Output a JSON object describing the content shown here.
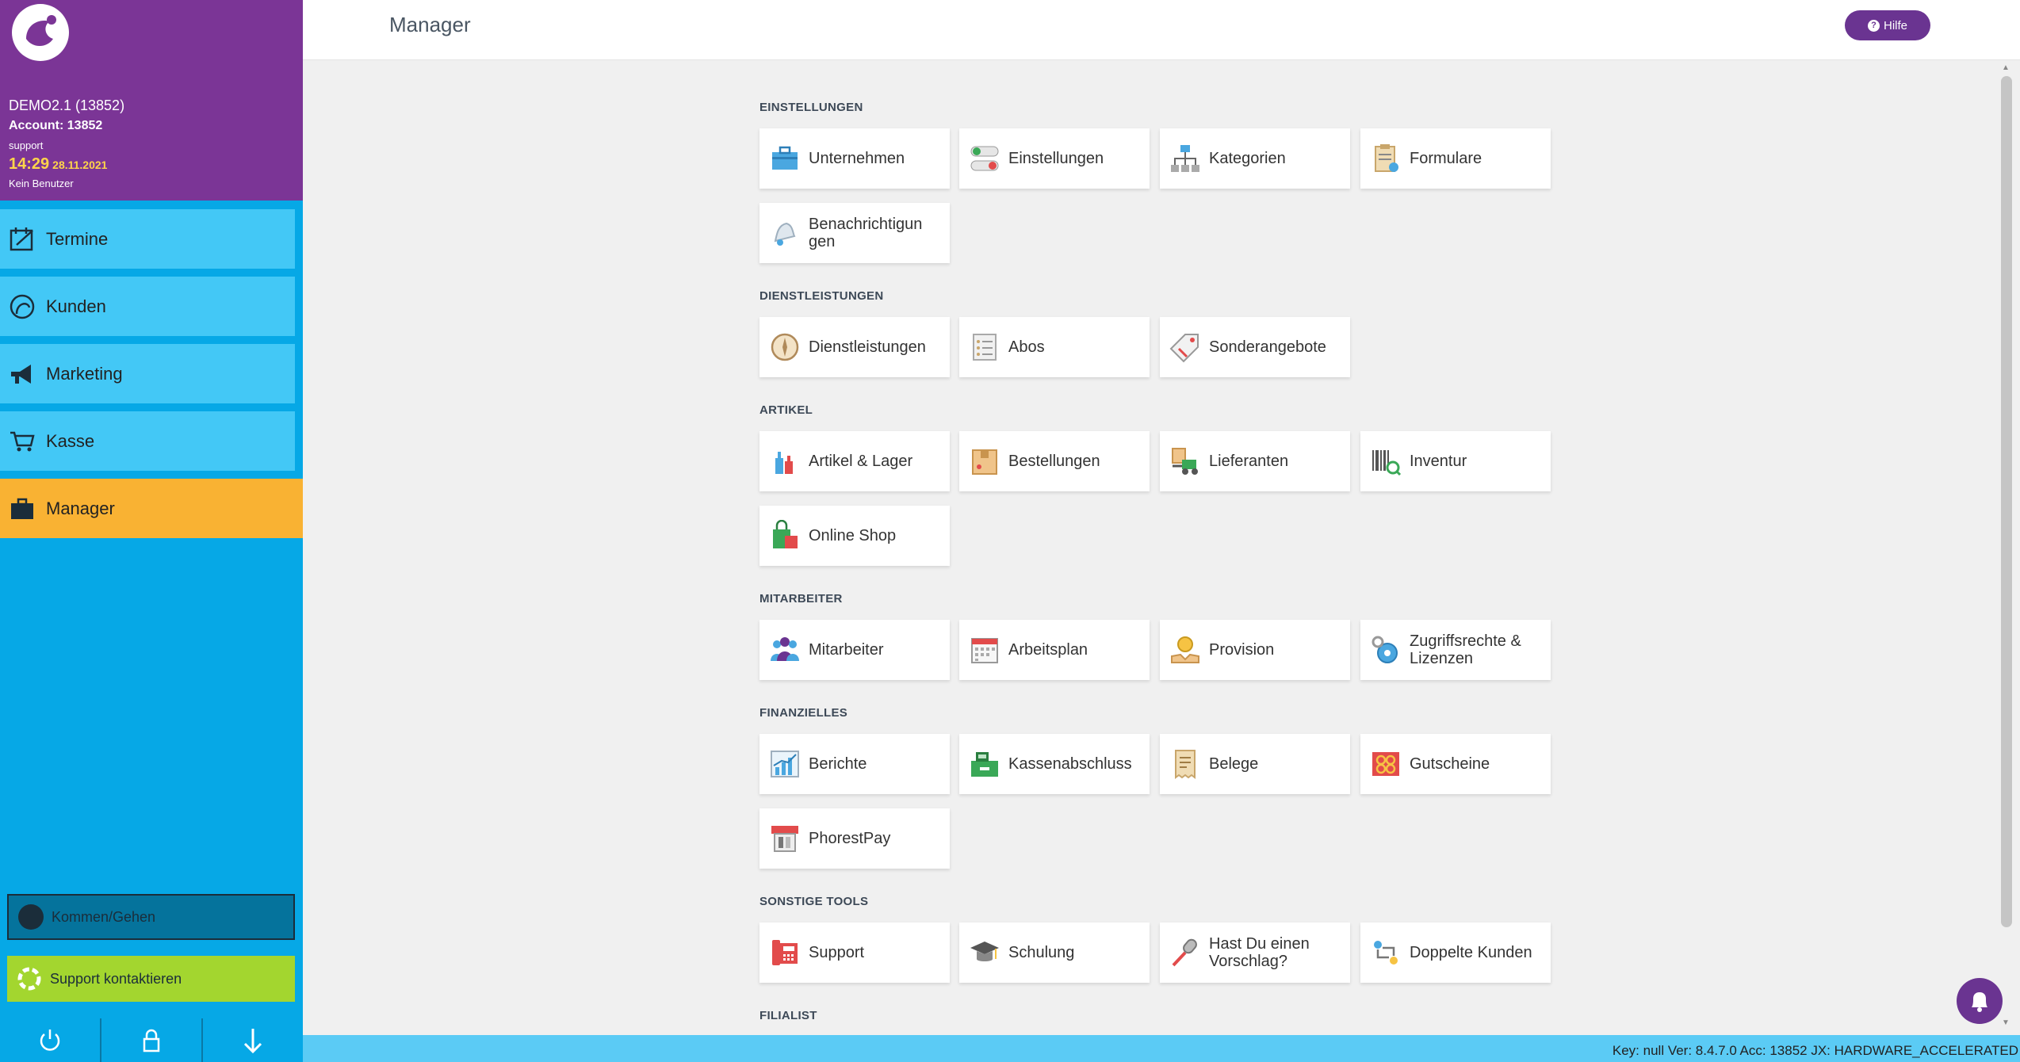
{
  "account": {
    "name": "DEMO2.1 (13852)",
    "number": "Account: 13852",
    "user": "support",
    "time": "14:29",
    "date": "28.11.2021",
    "no_user": "Kein Benutzer"
  },
  "nav": [
    {
      "label": "Termine",
      "icon": "calendar-icon"
    },
    {
      "label": "Kunden",
      "icon": "customer-icon"
    },
    {
      "label": "Marketing",
      "icon": "megaphone-icon"
    },
    {
      "label": "Kasse",
      "icon": "cart-icon"
    },
    {
      "label": "Manager",
      "icon": "briefcase-icon",
      "active": true
    }
  ],
  "sidebar_buttons": {
    "kommen": "Kommen/Gehen",
    "support": "Support kontaktieren"
  },
  "header": {
    "title": "Manager",
    "help": "Hilfe"
  },
  "sections": [
    {
      "title": "EINSTELLUNGEN",
      "tiles": [
        "Unternehmen",
        "Einstellungen",
        "Kategorien",
        "Formulare",
        "Benachrichtigungen"
      ]
    },
    {
      "title": "DIENSTLEISTUNGEN",
      "tiles": [
        "Dienstleistungen",
        "Abos",
        "Sonderangebote"
      ]
    },
    {
      "title": "ARTIKEL",
      "tiles": [
        "Artikel & Lager",
        "Bestellungen",
        "Lieferanten",
        "Inventur",
        "Online Shop"
      ]
    },
    {
      "title": "MITARBEITER",
      "tiles": [
        "Mitarbeiter",
        "Arbeitsplan",
        "Provision",
        "Zugriffsrechte & Lizenzen"
      ]
    },
    {
      "title": "FINANZIELLES",
      "tiles": [
        "Berichte",
        "Kassenabschluss",
        "Belege",
        "Gutscheine",
        "PhorestPay"
      ]
    },
    {
      "title": "SONSTIGE TOOLS",
      "tiles": [
        "Support",
        "Schulung",
        "Hast Du einen Vorschlag?",
        "Doppelte Kunden"
      ]
    },
    {
      "title": "FILIALIST",
      "tiles": []
    }
  ],
  "tile_labels_display": {
    "benachrichtigungen": "Benachrichtigun gen"
  },
  "status_bar": "Key: null Ver: 8.4.7.0 Acc: 13852  JX: HARDWARE_ACCELERATED",
  "colors": {
    "purple": "#7b3596",
    "sidebar_blue": "#06a8e6",
    "nav_blue": "#43c8f6",
    "active_orange": "#f9b233",
    "support_green": "#a3d62f"
  }
}
